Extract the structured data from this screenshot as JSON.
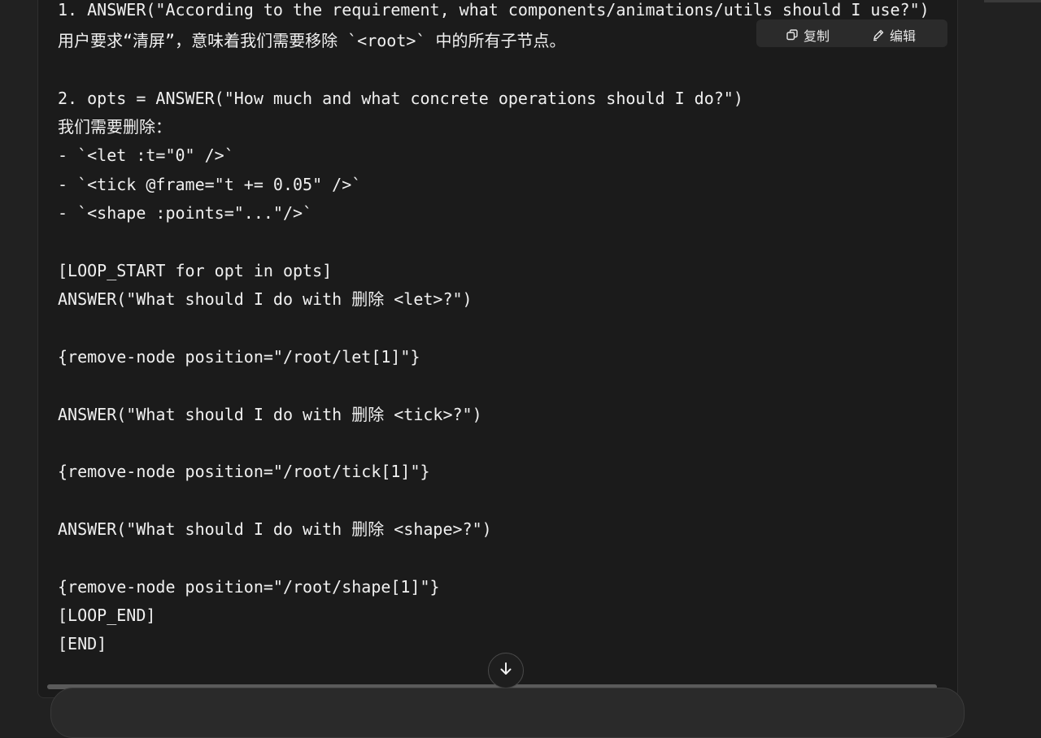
{
  "code_lines": [
    "1. ANSWER(\"According to the requirement, what components/animations/utils should I use?\")",
    "用户要求“清屏”，意味着我们需要移除 `<root>` 中的所有子节点。",
    "",
    "2. opts = ANSWER(\"How much and what concrete operations should I do?\")",
    "我们需要删除：",
    "- `<let :t=\"0\" />`",
    "- `<tick @frame=\"t += 0.05\" />`",
    "- `<shape :points=\"...\"/>`",
    "",
    "[LOOP_START for opt in opts]",
    "ANSWER(\"What should I do with 删除 <let>?\")",
    "",
    "{remove-node position=\"/root/let[1]\"}",
    "",
    "ANSWER(\"What should I do with 删除 <tick>?\")",
    "",
    "{remove-node position=\"/root/tick[1]\"}",
    "",
    "ANSWER(\"What should I do with 删除 <shape>?\")",
    "",
    "{remove-node position=\"/root/shape[1]\"}",
    "[LOOP_END]",
    "[END]"
  ],
  "toolbar": {
    "copy_label": "复制",
    "edit_label": "编辑",
    "copy_icon": "copy-icon",
    "edit_icon": "edit-pencil-icon"
  },
  "scroll_down_icon": "arrow-down-icon",
  "colors": {
    "page_bg": "#212121",
    "code_bg": "#1b1b1b",
    "text": "#f0f0f0",
    "toolbar_bg": "#2b2b2b"
  }
}
